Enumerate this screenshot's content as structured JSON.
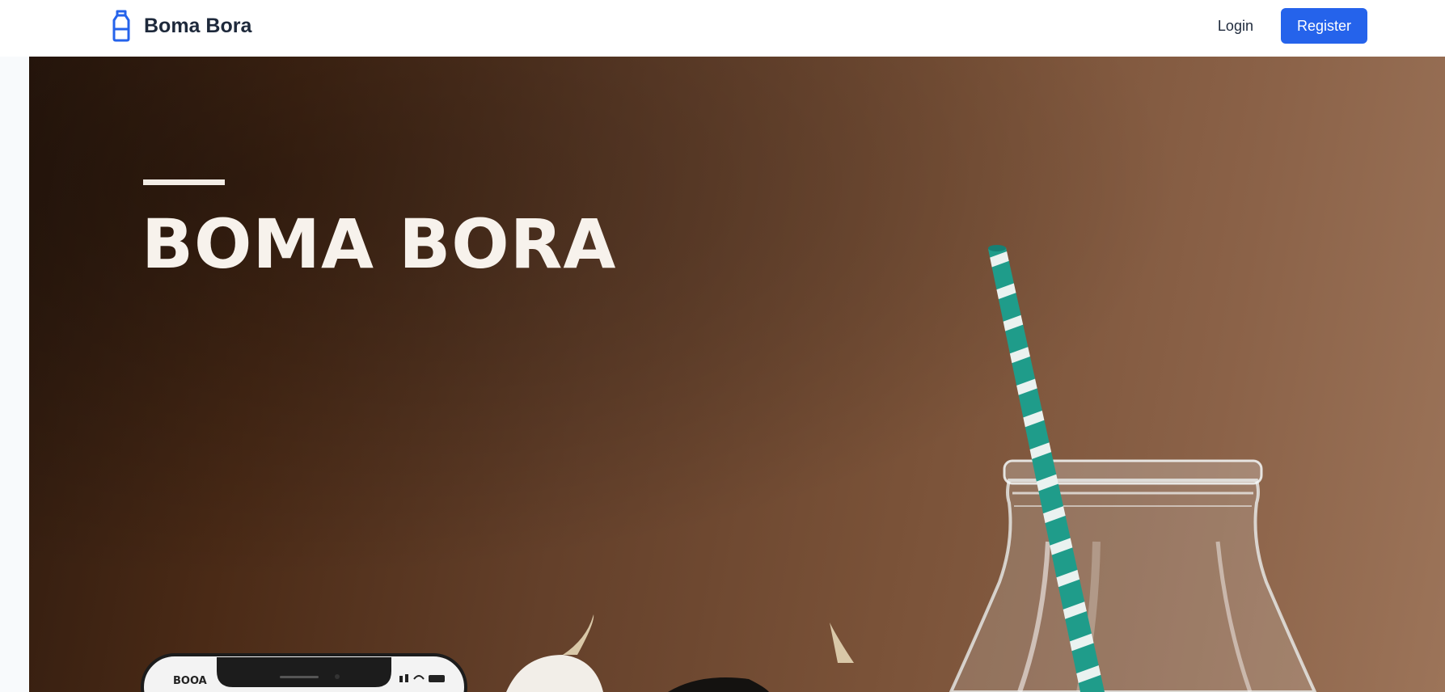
{
  "navbar": {
    "brand_name": "Boma Bora",
    "brand_icon": "milk-bottle-icon",
    "login_label": "Login",
    "register_label": "Register"
  },
  "hero": {
    "title": "BOMA BORA",
    "phone_screen_text": "BOOA",
    "objects": [
      "milk-bottle",
      "striped-straw",
      "smartphone",
      "cow"
    ]
  },
  "colors": {
    "brand": "#2563eb",
    "text_dark": "#1e293b",
    "hero_dark": "#2e1a0e",
    "hero_light": "#9c7459",
    "straw_green": "#1f9c8a"
  }
}
